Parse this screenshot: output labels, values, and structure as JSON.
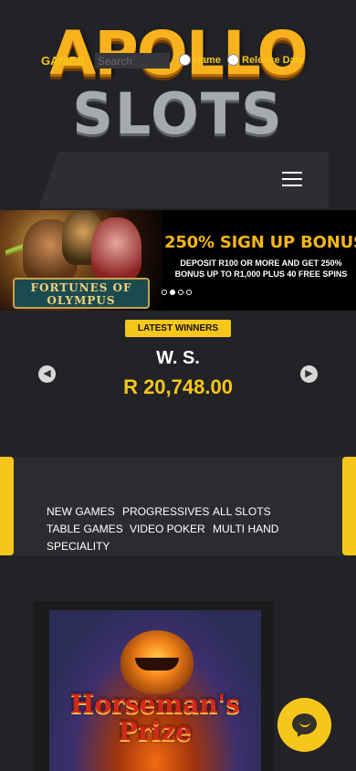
{
  "header": {
    "logo_top": "APOLLO",
    "logo_bottom": "SLOTS",
    "menu_icon": "hamburger-icon"
  },
  "banner": {
    "game_name": "FORTUNES OF OLYMPUS",
    "headline": "250% SIGN UP BONUS",
    "subtext": "DEPOSIT R100 OR MORE AND GET 250% BONUS UP TO R1,000 PLUS 40 FREE SPINS",
    "slide_count": 4,
    "active_slide": 2
  },
  "winners": {
    "badge": "LATEST WINNERS",
    "name": "W. S.",
    "amount": "R 20,748.00",
    "prev_icon": "chevron-left-icon",
    "next_icon": "chevron-right-icon"
  },
  "games": {
    "label": "GAMES",
    "search_placeholder": "Search",
    "sort_options": [
      "Name",
      "Release Date"
    ],
    "categories": [
      "NEW GAMES",
      "PROGRESSIVES",
      "ALL SLOTS",
      "TABLE GAMES",
      "VIDEO POKER",
      "MULTI HAND",
      "SPECIALITY"
    ]
  },
  "featured_game": {
    "title": "Horseman's Prize"
  },
  "chat": {
    "icon": "chat-bubble-icon"
  },
  "colors": {
    "background": "#222326",
    "accent": "#f7c61b",
    "logo_gold": "#f7b21d",
    "logo_stone": "#a7aaad"
  }
}
